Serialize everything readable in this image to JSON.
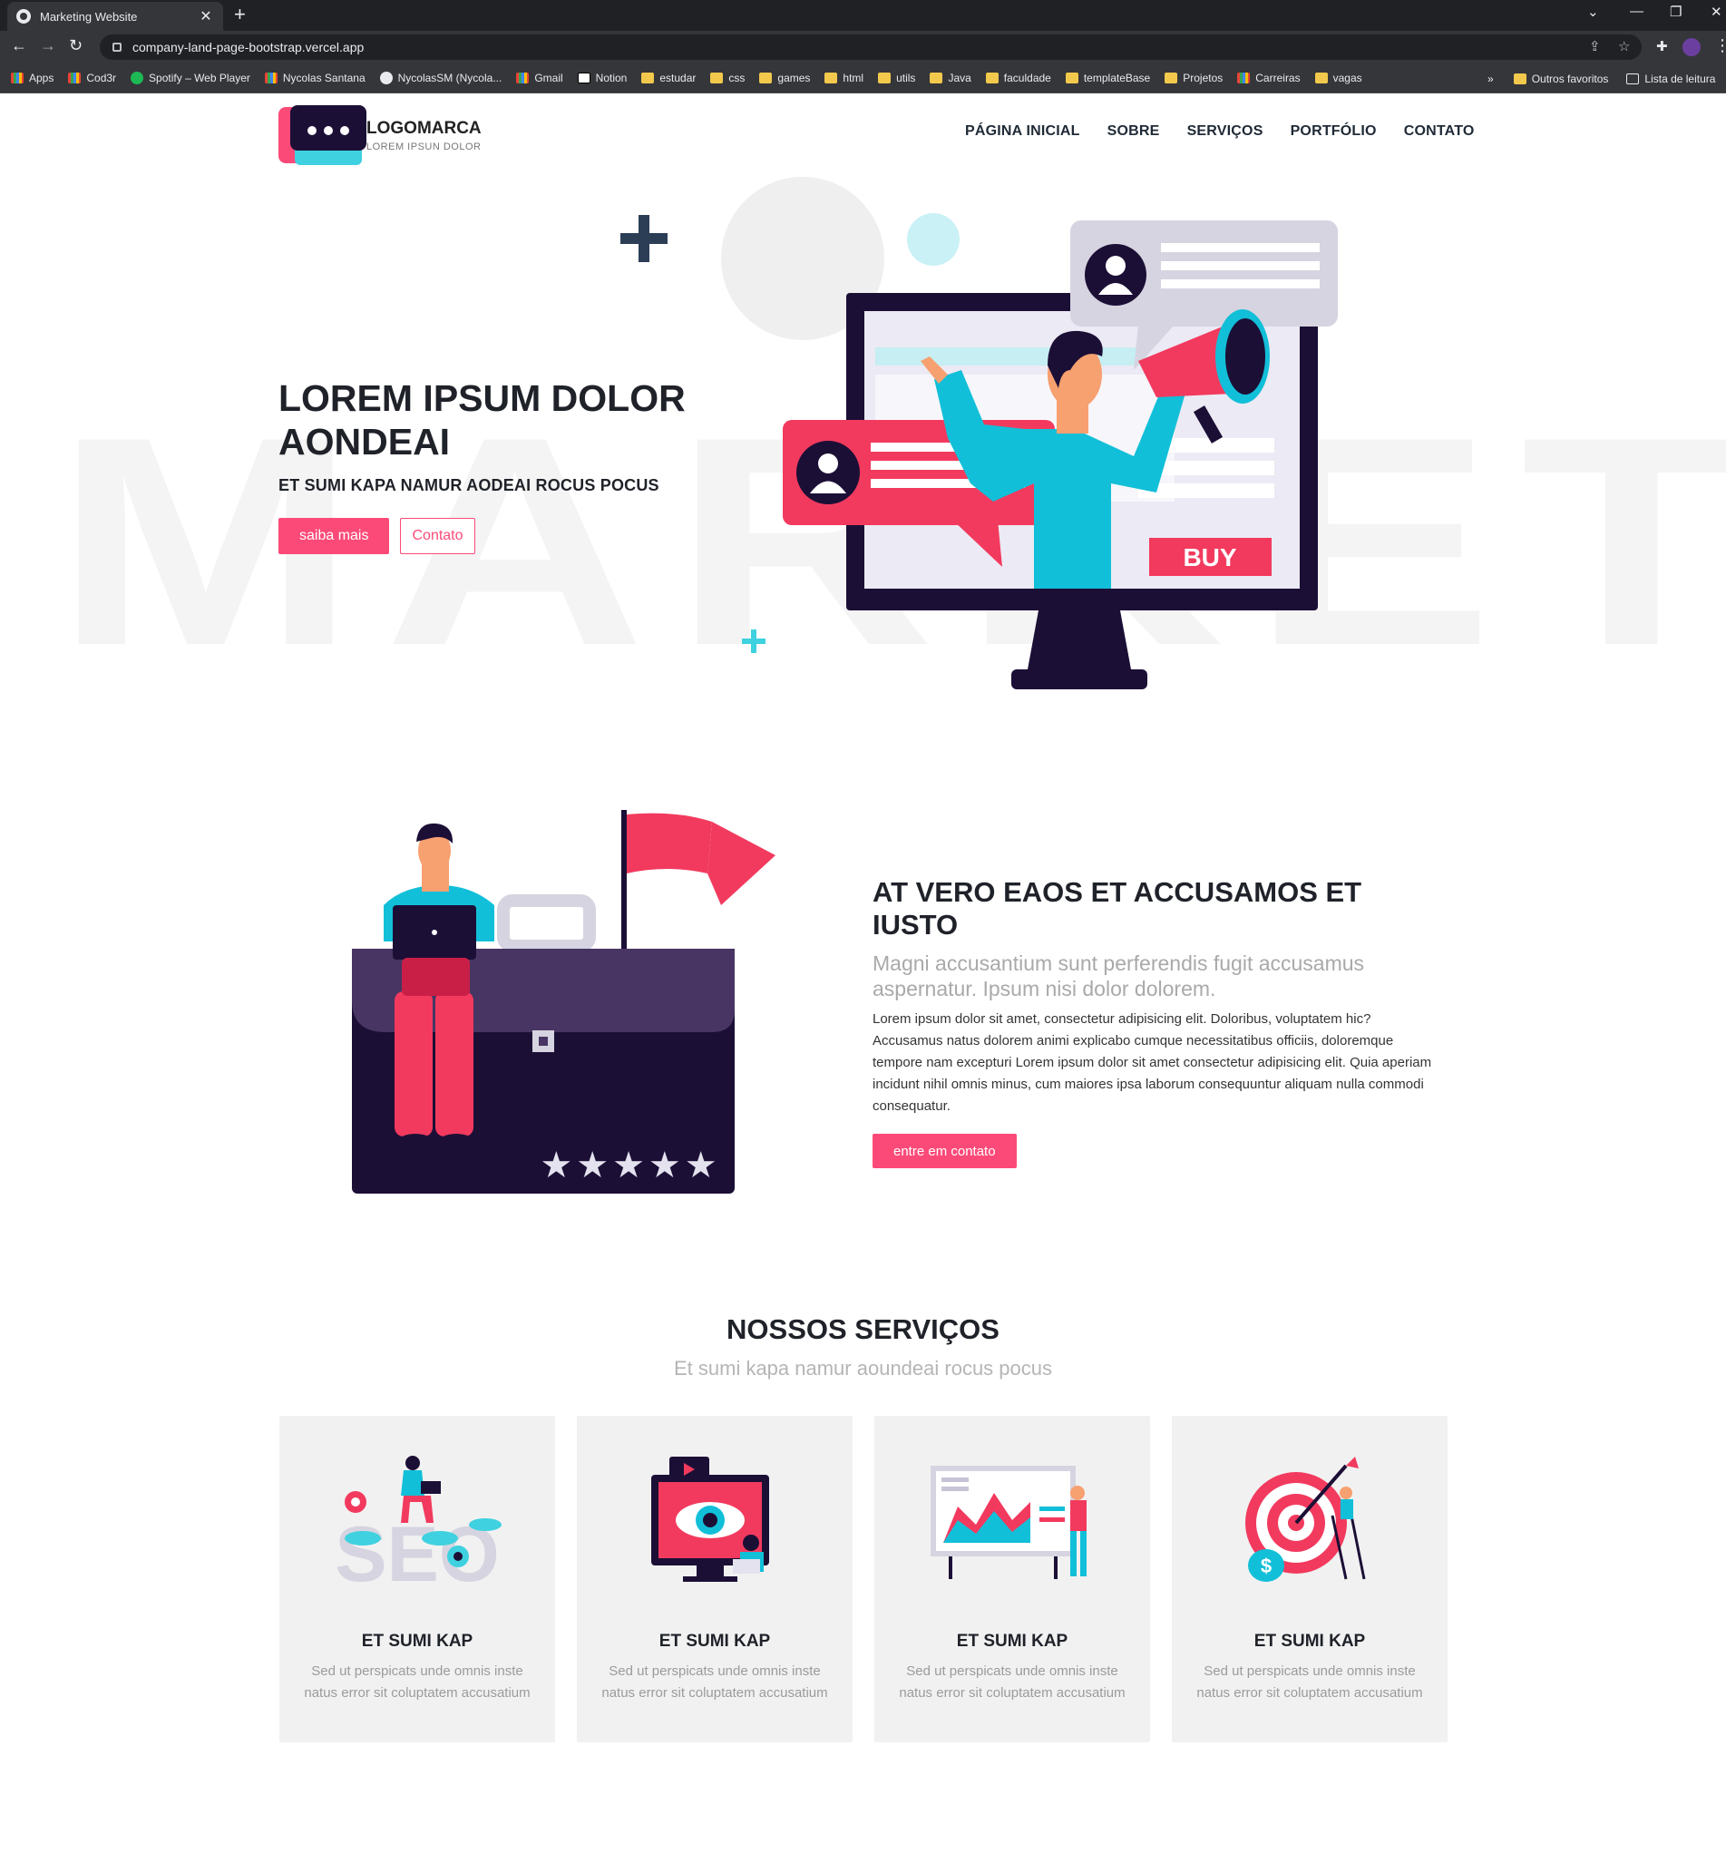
{
  "browser": {
    "tab_title": "Marketing Website",
    "url": "company-land-page-bootstrap.vercel.app",
    "bookmarks": [
      {
        "label": "Apps",
        "icon": "grid"
      },
      {
        "label": "Cod3r",
        "icon": "grid"
      },
      {
        "label": "Spotify – Web Player",
        "icon": "green"
      },
      {
        "label": "Nycolas Santana",
        "icon": "linkedin"
      },
      {
        "label": "NycolasSM (Nycola...",
        "icon": "dark"
      },
      {
        "label": "Gmail",
        "icon": "gmail"
      },
      {
        "label": "Notion",
        "icon": "notion"
      },
      {
        "label": "estudar",
        "icon": "folder"
      },
      {
        "label": "css",
        "icon": "folder"
      },
      {
        "label": "games",
        "icon": "folder"
      },
      {
        "label": "html",
        "icon": "folder"
      },
      {
        "label": "utils",
        "icon": "folder"
      },
      {
        "label": "Java",
        "icon": "folder"
      },
      {
        "label": "faculdade",
        "icon": "folder"
      },
      {
        "label": "templateBase",
        "icon": "folder"
      },
      {
        "label": "Projetos",
        "icon": "folder"
      },
      {
        "label": "Carreiras",
        "icon": "grid"
      },
      {
        "label": "vagas",
        "icon": "folder"
      }
    ],
    "more": "»",
    "other_bookmarks": "Outros favoritos",
    "reading_list": "Lista de leitura"
  },
  "site": {
    "background_word": "MARKETING",
    "logo": {
      "brand": "LOGOMARCA",
      "tagline": "LOREM IPSUN DOLOR"
    },
    "nav": [
      "PÁGINA INICIAL",
      "SOBRE",
      "SERVIÇOS",
      "PORTFÓLIO",
      "CONTATO"
    ],
    "hero": {
      "title_line1": "LOREM IPSUM DOLOR",
      "title_line2": "AONDEAI",
      "subtitle": "ET SUMI KAPA NAMUR AODEAI ROCUS POCUS",
      "primary_button": "saiba mais",
      "secondary_button": "Contato",
      "buy_label": "BUY"
    },
    "about": {
      "title": "AT VERO EAOS ET ACCUSAMOS ET IUSTO",
      "lead": "Magni accusantium sunt perferendis fugit accusamus aspernatur. Ipsum nisi dolor dolorem.",
      "body": "Lorem ipsum dolor sit amet, consectetur adipisicing elit. Doloribus, voluptatem hic? Accusamus natus dolorem animi explicabo cumque necessitatibus officiis, doloremque tempore nam excepturi Lorem ipsum dolor sit amet consectetur adipisicing elit. Quia aperiam incidunt nihil omnis minus, cum maiores ipsa laborum consequuntur aliquam nulla commodi consequatur.",
      "button": "entre em contato"
    },
    "services": {
      "title": "NOSSOS SERVIÇOS",
      "subtitle": "Et sumi kapa namur aoundeai rocus pocus",
      "cards": [
        {
          "title": "ET SUMI KAP",
          "text": "Sed ut perspicats unde omnis inste natus error sit coluptatem accusatium",
          "illustration": "seo"
        },
        {
          "title": "ET SUMI KAP",
          "text": "Sed ut perspicats unde omnis inste natus error sit coluptatem accusatium",
          "illustration": "video"
        },
        {
          "title": "ET SUMI KAP",
          "text": "Sed ut perspicats unde omnis inste natus error sit coluptatem accusatium",
          "illustration": "analytics"
        },
        {
          "title": "ET SUMI KAP",
          "text": "Sed ut perspicats unde omnis inste natus error sit coluptatem accusatium",
          "illustration": "target"
        }
      ]
    }
  },
  "colors": {
    "accent": "#fc4a78",
    "cyan": "#3fd1e0",
    "navy": "#1c0f36",
    "purple": "#483563"
  }
}
